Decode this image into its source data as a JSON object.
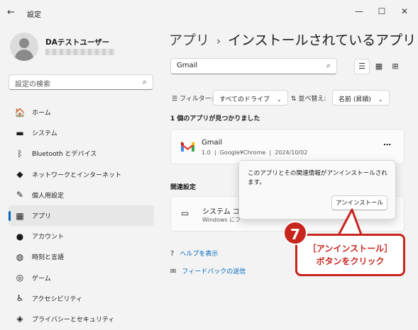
{
  "window": {
    "title": "設定",
    "back_icon": "←",
    "controls": {
      "minimize": "—",
      "maximize": "☐",
      "close": "✕"
    }
  },
  "user": {
    "name": "DAテストユーザー"
  },
  "sidebar": {
    "search_placeholder": "設定の検索",
    "items": [
      {
        "label": "ホーム",
        "icon": "🏠",
        "icon_name": "home-icon"
      },
      {
        "label": "システム",
        "icon": "▬",
        "icon_name": "system-icon"
      },
      {
        "label": "Bluetooth とデバイス",
        "icon": "ᛒ",
        "icon_name": "bluetooth-icon"
      },
      {
        "label": "ネットワークとインターネット",
        "icon": "◆",
        "icon_name": "network-icon"
      },
      {
        "label": "個人用設定",
        "icon": "✎",
        "icon_name": "brush-icon"
      },
      {
        "label": "アプリ",
        "icon": "▦",
        "icon_name": "apps-icon"
      },
      {
        "label": "アカウント",
        "icon": "●",
        "icon_name": "account-icon"
      },
      {
        "label": "時刻と言語",
        "icon": "◍",
        "icon_name": "time-language-icon"
      },
      {
        "label": "ゲーム",
        "icon": "◎",
        "icon_name": "gaming-icon"
      },
      {
        "label": "アクセシビリティ",
        "icon": "♿",
        "icon_name": "accessibility-icon"
      },
      {
        "label": "プライバシーとセキュリティ",
        "icon": "◈",
        "icon_name": "shield-icon"
      }
    ],
    "active_index": 5,
    "accent": "#0067c0"
  },
  "header": {
    "breadcrumb": [
      "アプリ",
      "インストールされているアプリ"
    ],
    "separator": "›"
  },
  "search": {
    "value": "Gmail"
  },
  "filters": {
    "filter_label": "フィルター:",
    "filter_value": "すべてのドライブ",
    "sort_label": "並べ替え:",
    "sort_value": "名前 (昇順)"
  },
  "results_count": "1 個のアプリが見つかりました",
  "app": {
    "name": "Gmail",
    "version": "1.0",
    "publisher": "Google¥Chrome",
    "date": "2024/10/02",
    "more": "⋯"
  },
  "related": {
    "heading": "関連設定",
    "system_title": "システム コン",
    "system_sub": "Windows にプ"
  },
  "links": [
    {
      "label": "ヘルプを表示",
      "icon": "?"
    },
    {
      "label": "フィードバックの送信",
      "icon": "✉"
    }
  ],
  "flyout": {
    "message": "このアプリとその関連情報がアンインストールされます。",
    "button": "アンインストール"
  },
  "annotation": {
    "step": "7",
    "line1": "［アンインストール］",
    "line2": "ボタンをクリック",
    "color": "#c8251e"
  }
}
